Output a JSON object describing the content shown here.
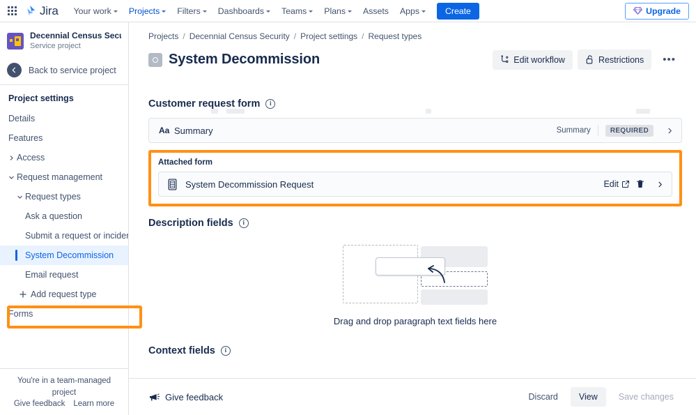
{
  "topnav": {
    "app_switcher_icon": "grid-apps-icon",
    "brand": "Jira",
    "items": [
      {
        "label": "Your work",
        "has_caret": true,
        "active": false
      },
      {
        "label": "Projects",
        "has_caret": true,
        "active": true
      },
      {
        "label": "Filters",
        "has_caret": true,
        "active": false
      },
      {
        "label": "Dashboards",
        "has_caret": true,
        "active": false
      },
      {
        "label": "Teams",
        "has_caret": true,
        "active": false
      },
      {
        "label": "Plans",
        "has_caret": true,
        "active": false
      },
      {
        "label": "Assets",
        "has_caret": false,
        "active": false
      },
      {
        "label": "Apps",
        "has_caret": true,
        "active": false
      }
    ],
    "create_label": "Create",
    "upgrade_label": "Upgrade",
    "upgrade_icon": "diamond-icon"
  },
  "sidebar": {
    "project_name": "Decennial Census Secu...",
    "project_subtitle": "Service project",
    "project_icon": "project-avatar-icon",
    "back_label": "Back to service project",
    "back_icon": "arrow-left-circle-icon",
    "settings_title": "Project settings",
    "items": [
      {
        "label": "Details",
        "level": 1,
        "chevron": "",
        "selected": false
      },
      {
        "label": "Features",
        "level": 1,
        "chevron": "",
        "selected": false
      },
      {
        "label": "Access",
        "level": 1,
        "chevron": "right",
        "selected": false
      },
      {
        "label": "Request management",
        "level": 1,
        "chevron": "down",
        "selected": false
      },
      {
        "label": "Request types",
        "level": 2,
        "chevron": "down",
        "selected": false
      },
      {
        "label": "Ask a question",
        "level": 3,
        "chevron": "",
        "selected": false
      },
      {
        "label": "Submit a request or incident",
        "level": 3,
        "chevron": "",
        "selected": false
      },
      {
        "label": "System Decommission",
        "level": 3,
        "chevron": "",
        "selected": true
      },
      {
        "label": "Email request",
        "level": 3,
        "chevron": "",
        "selected": false
      }
    ],
    "add_request_type": "Add request type",
    "add_icon": "plus-icon",
    "forms_label": "Forms",
    "footer_note": "You're in a team-managed project",
    "footer_give_feedback": "Give feedback",
    "footer_learn_more": "Learn more"
  },
  "breadcrumb": [
    "Projects",
    "Decennial Census Security",
    "Project settings",
    "Request types"
  ],
  "page": {
    "title": "System Decommission",
    "title_icon": "request-type-icon",
    "edit_workflow_label": "Edit workflow",
    "edit_workflow_icon": "workflow-icon",
    "restrictions_label": "Restrictions",
    "restrictions_icon": "unlock-icon",
    "more_label": "•••",
    "more_icon": "more-actions-icon"
  },
  "customer_request_form": {
    "heading": "Customer request form",
    "info_icon": "info-icon",
    "fields": [
      {
        "type_icon": "text-aa-icon",
        "name": "Summary",
        "field_type": "Summary",
        "badge": "REQUIRED",
        "chevron_icon": "chevron-right-icon"
      }
    ]
  },
  "attached_form": {
    "label": "Attached form",
    "form_icon": "form-document-icon",
    "name": "System Decommission Request",
    "edit_label": "Edit",
    "edit_icon": "external-link-icon",
    "delete_icon": "trash-icon",
    "chevron_icon": "chevron-right-icon",
    "highlight_color": "#FF9016"
  },
  "description_fields": {
    "heading": "Description fields",
    "info_icon": "info-icon",
    "dropzone_text": "Drag and drop paragraph text fields here",
    "dropzone_illustration_icon": "drag-drop-illustration"
  },
  "context_fields": {
    "heading": "Context fields",
    "info_icon": "info-icon"
  },
  "footer": {
    "feedback_label": "Give feedback",
    "feedback_icon": "megaphone-icon",
    "discard_label": "Discard",
    "view_label": "View",
    "save_label": "Save changes",
    "save_disabled": true
  },
  "colors": {
    "brand_blue": "#0C66E4",
    "highlight_orange": "#FF9016",
    "selected_row_bg": "#E9F2FF",
    "text_primary": "#172B4D",
    "text_subtle": "#42526E"
  }
}
